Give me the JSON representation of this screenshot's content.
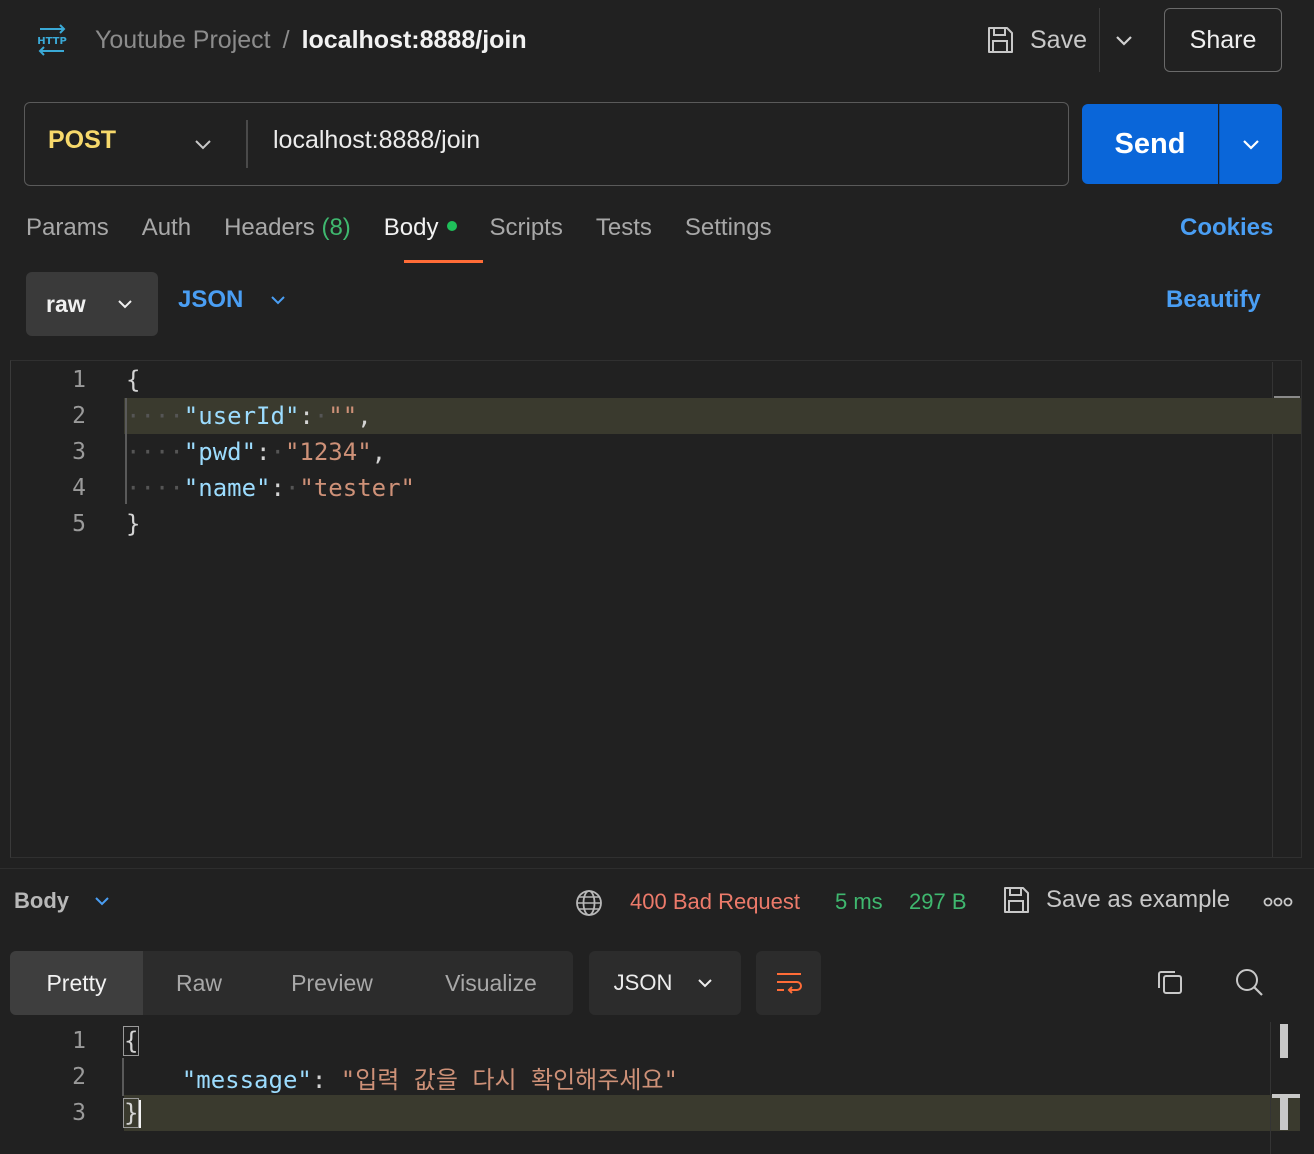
{
  "header": {
    "icon": "http-icon",
    "collection": "Youtube Project",
    "separator": "/",
    "request_name": "localhost:8888/join",
    "save_label": "Save",
    "share_label": "Share"
  },
  "request": {
    "method": "POST",
    "url": "localhost:8888/join",
    "send_label": "Send"
  },
  "tabs": [
    {
      "label": "Params"
    },
    {
      "label": "Auth"
    },
    {
      "label": "Headers",
      "count": "(8)"
    },
    {
      "label": "Body",
      "active": true
    },
    {
      "label": "Scripts"
    },
    {
      "label": "Tests"
    },
    {
      "label": "Settings"
    }
  ],
  "cookies_label": "Cookies",
  "body_mode": {
    "mode": "raw",
    "language": "JSON",
    "beautify_label": "Beautify"
  },
  "request_body": {
    "line_numbers": [
      "1",
      "2",
      "3",
      "4",
      "5"
    ],
    "open_brace": "{",
    "close_brace": "}",
    "fields": [
      {
        "key": "\"userId\"",
        "value": "\"\"",
        "trail": ","
      },
      {
        "key": "\"pwd\"",
        "value": "\"1234\"",
        "trail": ","
      },
      {
        "key": "\"name\"",
        "value": "\"tester\"",
        "trail": ""
      }
    ]
  },
  "response": {
    "body_label": "Body",
    "status": "400 Bad Request",
    "time": "5 ms",
    "size": "297 B",
    "save_example_label": "Save as example",
    "views": [
      "Pretty",
      "Raw",
      "Preview",
      "Visualize"
    ],
    "format": "JSON",
    "line_numbers": [
      "1",
      "2",
      "3"
    ],
    "open_brace": "{",
    "close_brace": "}",
    "message_key": "\"message\"",
    "message_value": "\"입력 값을 다시 확인해주세요\""
  },
  "colors": {
    "accent_orange": "#ff6c37",
    "send_blue": "#0a66d9",
    "link_blue": "#4a9ef3",
    "method_yellow": "#f7d96b",
    "status_red": "#ec7a6a",
    "success_green": "#3fb86f"
  }
}
